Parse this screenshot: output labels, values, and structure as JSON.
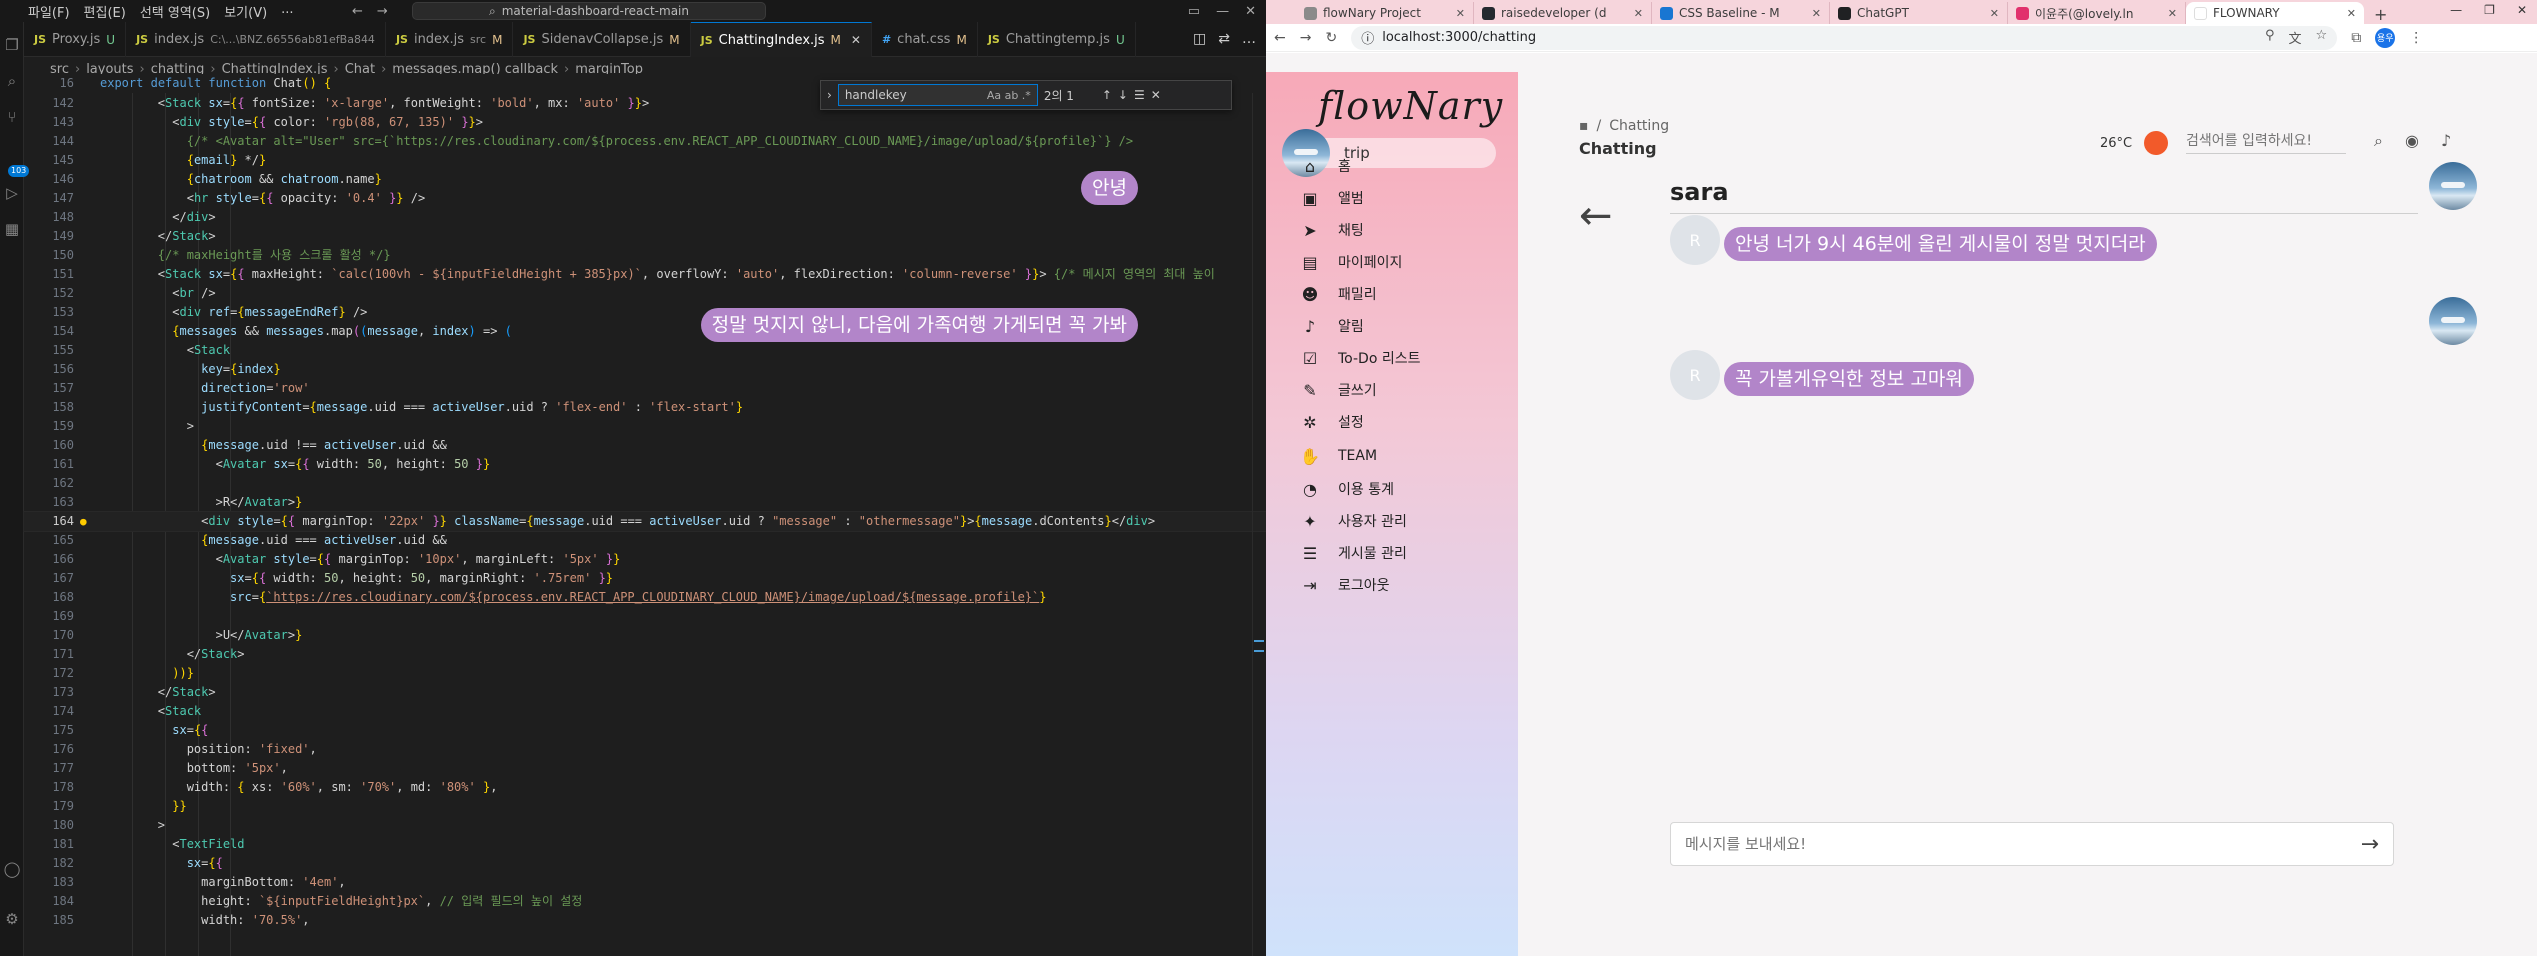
{
  "vscode": {
    "menu": [
      "파일(F)",
      "편집(E)",
      "선택 영역(S)",
      "보기(V)",
      "..."
    ],
    "command_center": "material-dashboard-react-main",
    "tabs": [
      {
        "type": "JS",
        "name": "Proxy.js",
        "status": "U",
        "path": ""
      },
      {
        "type": "JS",
        "name": "index.js",
        "status": "",
        "path": "C:\\...\\BNZ.66556ab81efBa844"
      },
      {
        "type": "JS",
        "name": "index.js",
        "status": "M",
        "path": "src"
      },
      {
        "type": "JS",
        "name": "SidenavCollapse.js",
        "status": "M",
        "path": ""
      },
      {
        "type": "JS",
        "name": "ChattingIndex.js",
        "status": "M",
        "path": "",
        "active": true
      },
      {
        "type": "#",
        "name": "chat.css",
        "status": "M",
        "path": ""
      },
      {
        "type": "JS",
        "name": "Chattingtemp.js",
        "status": "U",
        "path": ""
      }
    ],
    "breadcrumb": [
      "src",
      "layouts",
      "chatting",
      "ChattingIndex.js",
      "Chat",
      "messages.map() callback",
      "marginTop"
    ],
    "find": {
      "query": "handlekey",
      "options": "Aa  ab  .*",
      "count": "2의 1"
    },
    "activity_badge": "103",
    "sticky_line": {
      "num": "16",
      "text": "export default function Chat() {"
    },
    "code": [
      {
        "num": "142",
        "text": "        <Stack sx={{ fontSize: 'x-large', fontWeight: 'bold', mx: 'auto' }}>"
      },
      {
        "num": "143",
        "text": "          <div style={{ color: 'rgb(88, 67, 135)' }}>"
      },
      {
        "num": "144",
        "text": "            {/* <Avatar alt=\"User\" src={`https://res.cloudinary.com/${process.env.REACT_APP_CLOUDINARY_CLOUD_NAME}/image/upload/${profile}`} />"
      },
      {
        "num": "145",
        "text": "            {email} */}"
      },
      {
        "num": "146",
        "text": "            {chatroom && chatroom.name}"
      },
      {
        "num": "147",
        "text": "            <hr style={{ opacity: '0.4' }} />"
      },
      {
        "num": "148",
        "text": "          </div>"
      },
      {
        "num": "149",
        "text": "        </Stack>"
      },
      {
        "num": "150",
        "text": "        {/* maxHeight를 사용 스크롤 활성 */}"
      },
      {
        "num": "151",
        "text": "        <Stack sx={{ maxHeight: `calc(100vh - ${inputFieldHeight + 385}px)`, overflowY: 'auto', flexDirection: 'column-reverse' }}> {/* 메시지 영역의 최대 높이"
      },
      {
        "num": "152",
        "text": "          <br />"
      },
      {
        "num": "153",
        "text": "          <div ref={messageEndRef} />"
      },
      {
        "num": "154",
        "text": "          {messages && messages.map((message, index) => ("
      },
      {
        "num": "155",
        "text": "            <Stack"
      },
      {
        "num": "156",
        "text": "              key={index}"
      },
      {
        "num": "157",
        "text": "              direction='row'"
      },
      {
        "num": "158",
        "text": "              justifyContent={message.uid === activeUser.uid ? 'flex-end' : 'flex-start'}"
      },
      {
        "num": "159",
        "text": "            >"
      },
      {
        "num": "160",
        "text": "              {message.uid !== activeUser.uid &&"
      },
      {
        "num": "161",
        "text": "                <Avatar sx={{ width: 50, height: 50 }}"
      },
      {
        "num": "162",
        "text": ""
      },
      {
        "num": "163",
        "text": "                >R</Avatar>}"
      },
      {
        "num": "164",
        "text": "              <div style={{ marginTop: '22px' }} className={message.uid === activeUser.uid ? \"message\" : \"othermessage\"}>{message.dContents}</div>"
      },
      {
        "num": "165",
        "text": "              {message.uid === activeUser.uid &&"
      },
      {
        "num": "166",
        "text": "                <Avatar style={{ marginTop: '10px', marginLeft: '5px' }}"
      },
      {
        "num": "167",
        "text": "                  sx={{ width: 50, height: 50, marginRight: '.75rem' }}"
      },
      {
        "num": "168",
        "text": "                  src={`https://res.cloudinary.com/${process.env.REACT_APP_CLOUDINARY_CLOUD_NAME}/image/upload/${message.profile}`}"
      },
      {
        "num": "169",
        "text": ""
      },
      {
        "num": "170",
        "text": "                >U</Avatar>}"
      },
      {
        "num": "171",
        "text": "            </Stack>"
      },
      {
        "num": "172",
        "text": "          ))}"
      },
      {
        "num": "173",
        "text": "        </Stack>"
      },
      {
        "num": "174",
        "text": "        <Stack"
      },
      {
        "num": "175",
        "text": "          sx={{"
      },
      {
        "num": "176",
        "text": "            position: 'fixed',"
      },
      {
        "num": "177",
        "text": "            bottom: '5px',"
      },
      {
        "num": "178",
        "text": "            width: { xs: '60%', sm: '70%', md: '80%' },"
      },
      {
        "num": "179",
        "text": "          }}"
      },
      {
        "num": "180",
        "text": "        >"
      },
      {
        "num": "181",
        "text": "          <TextField"
      },
      {
        "num": "182",
        "text": "            sx={{"
      },
      {
        "num": "183",
        "text": "              marginBottom: '4em',"
      },
      {
        "num": "184",
        "text": "              height: `${inputFieldHeight}px`, // 입력 필드의 높이 설정"
      },
      {
        "num": "185",
        "text": "              width: '70.5%',"
      }
    ]
  },
  "chrome": {
    "tabs": [
      {
        "title": "flowNary Project",
        "color": "#8a8a8a"
      },
      {
        "title": "raisedeveloper (d",
        "color": "#24292f"
      },
      {
        "title": "CSS Baseline - M",
        "color": "#1976d2"
      },
      {
        "title": "ChatGPT",
        "color": "#202123"
      },
      {
        "title": "이윤주(@lovely.ln",
        "color": "#e1306c"
      },
      {
        "title": "FLOWNARY",
        "color": "#ffffff",
        "active": true
      }
    ],
    "url": "localhost:3000/chatting",
    "profile_initials": "용우"
  },
  "app": {
    "logo": "flowNary",
    "user_name": "trip",
    "nav": [
      {
        "icon": "home-icon",
        "glyph": "⌂",
        "label": "홈"
      },
      {
        "icon": "album-icon",
        "glyph": "▣",
        "label": "앨범"
      },
      {
        "icon": "send-icon",
        "glyph": "➤",
        "label": "채팅"
      },
      {
        "icon": "mypage-icon",
        "glyph": "▤",
        "label": "마이페이지"
      },
      {
        "icon": "family-icon",
        "glyph": "☻",
        "label": "패밀리"
      },
      {
        "icon": "bell-icon",
        "glyph": "♪",
        "label": "알림"
      },
      {
        "icon": "checklist-icon",
        "glyph": "☑",
        "label": "To-Do 리스트"
      },
      {
        "icon": "write-icon",
        "glyph": "✎",
        "label": "글쓰기"
      },
      {
        "icon": "gear-icon",
        "glyph": "✲",
        "label": "설정"
      },
      {
        "icon": "team-icon",
        "glyph": "✋",
        "label": "TEAM"
      },
      {
        "icon": "chart-icon",
        "glyph": "◔",
        "label": "이용 통계"
      },
      {
        "icon": "user-manage-icon",
        "glyph": "✦",
        "label": "사용자 관리"
      },
      {
        "icon": "post-manage-icon",
        "glyph": "☰",
        "label": "게시물 관리"
      },
      {
        "icon": "logout-icon",
        "glyph": "⇥",
        "label": "로그아웃"
      }
    ],
    "breadcrumb_parent": "Chatting",
    "page_title": "Chatting",
    "temperature": "26°C",
    "search_placeholder": "검색어를 입력하세요!",
    "room_name": "sara",
    "messages": [
      {
        "from": "me",
        "text": "안녕"
      },
      {
        "from": "other",
        "avatar": "R",
        "text": "안녕 너가 9시 46분에 올린 게시물이 정말 멋지더라"
      },
      {
        "from": "me",
        "text": "정말 멋지지 않니, 다음에 가족여행 가게되면 꼭 가봐"
      },
      {
        "from": "other",
        "avatar": "R",
        "text": "꼭 가볼게유익한 정보 고마워"
      }
    ],
    "message_placeholder": "메시지를 보내세요!",
    "bubble_color": "#b285c9"
  }
}
